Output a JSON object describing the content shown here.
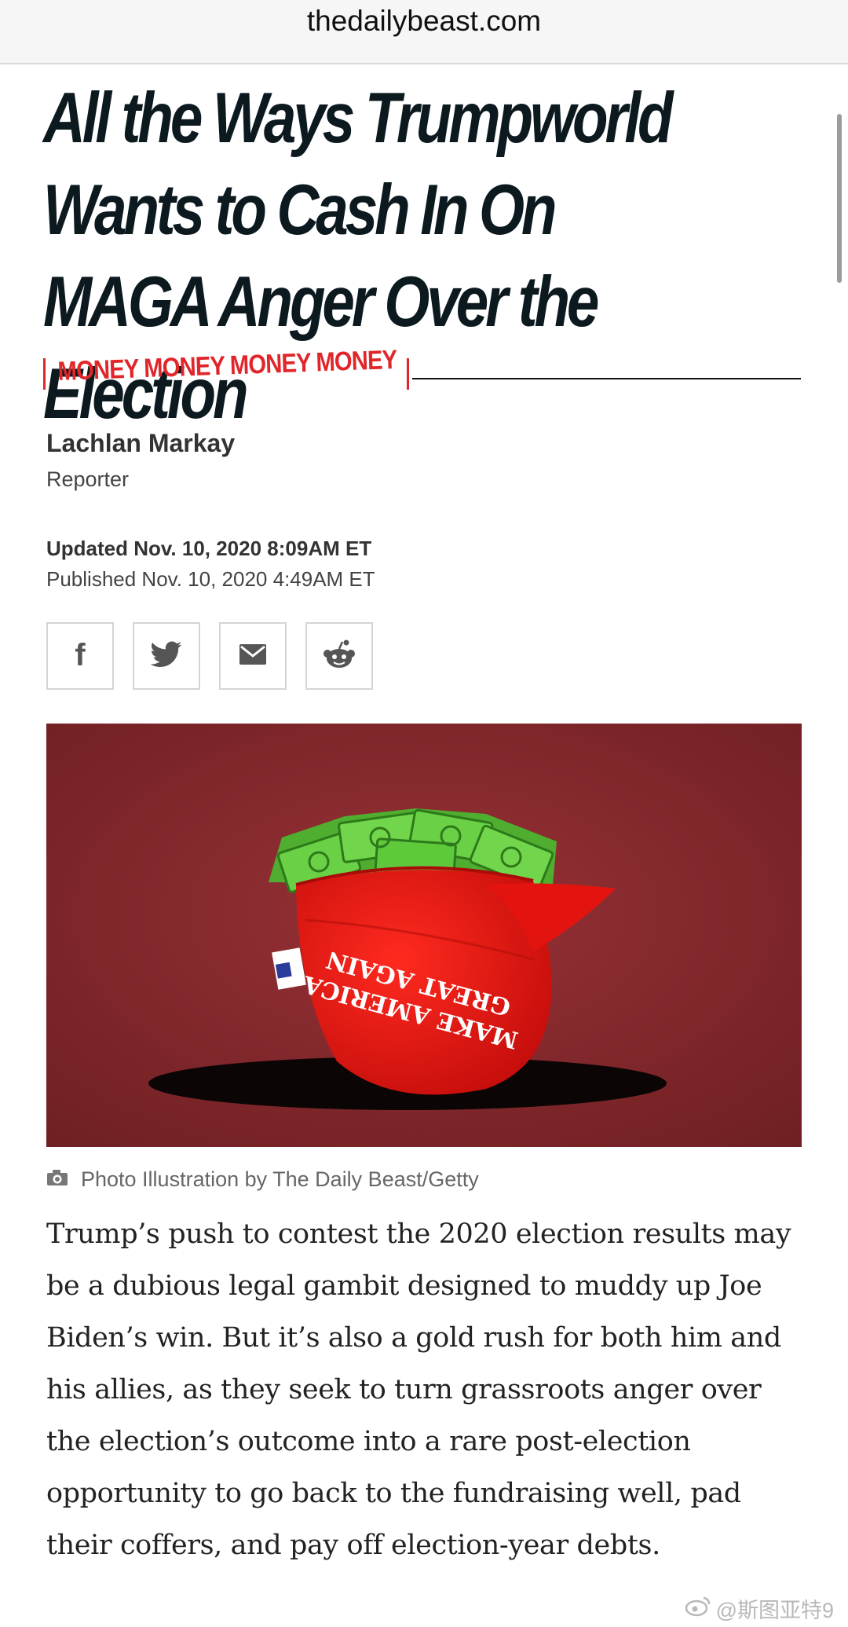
{
  "browser": {
    "url": "thedailybeast.com"
  },
  "article": {
    "headline": "All the Ways Trumpworld Wants to Cash In On MAGA Anger Over the Election",
    "kicker": "MONEY MONEY MONEY MONEY",
    "author": "Lachlan Markay",
    "role": "Reporter",
    "updated": "Updated Nov. 10, 2020 8:09AM ET",
    "published": "Published Nov. 10, 2020 4:49AM ET",
    "share": [
      "facebook-icon",
      "twitter-icon",
      "email-icon",
      "reddit-icon"
    ],
    "hero": {
      "cap_text_line1": "MAKE AMERICA",
      "cap_text_line2": "GREAT AGAIN"
    },
    "caption": "Photo Illustration by The Daily Beast/Getty",
    "body": "Trump’s push to contest the 2020 election results may be a dubious legal gambit designed to muddy up Joe Biden’s win. But it’s also a gold rush for both him and his allies, as they seek to turn grassroots anger over the election’s outcome into a rare post-election opportunity to go back to the fundraising well, pad their coffers, and pay off election-year debts."
  },
  "watermark": "@斯图亚特9",
  "colors": {
    "accent": "#e0262a",
    "headline": "#0c1a20",
    "hero_bg": "#8e2b2e",
    "cap": "#e3140f",
    "money": "#63c43f"
  }
}
